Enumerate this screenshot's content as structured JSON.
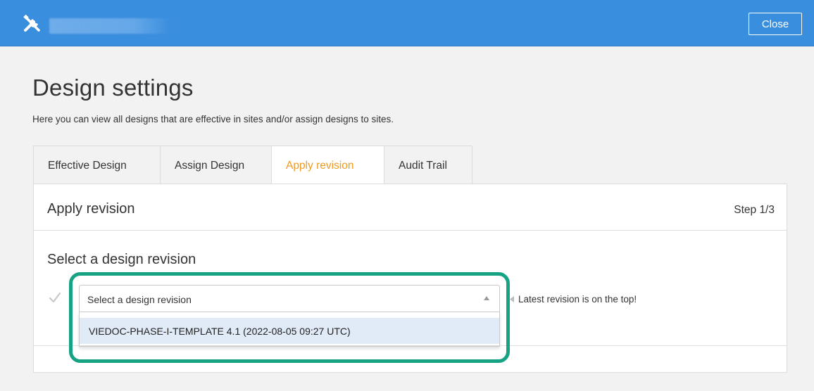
{
  "header": {
    "tools_icon": "tools-icon",
    "close_label": "Close",
    "bar_color": "#3a8ede"
  },
  "page": {
    "title": "Design settings",
    "description": "Here you can view all designs that are effective in sites and/or assign designs to sites."
  },
  "tabs": [
    {
      "label": "Effective Design",
      "active": false
    },
    {
      "label": "Assign Design",
      "active": false
    },
    {
      "label": "Apply revision",
      "active": true
    },
    {
      "label": "Audit Trail",
      "active": false
    }
  ],
  "panel": {
    "title": "Apply revision",
    "step": "Step 1/3",
    "section_title": "Select a design revision",
    "select": {
      "placeholder": "Select a design revision",
      "options": [
        "VIEDOC-PHASE-I-TEMPLATE 4.1 (2022-08-05 09:27 UTC)"
      ]
    },
    "hint": "Latest revision is on the top!"
  },
  "colors": {
    "accent_tab": "#f09a1d",
    "highlight_border": "#16a384",
    "option_highlight": "#e1ebf8"
  }
}
